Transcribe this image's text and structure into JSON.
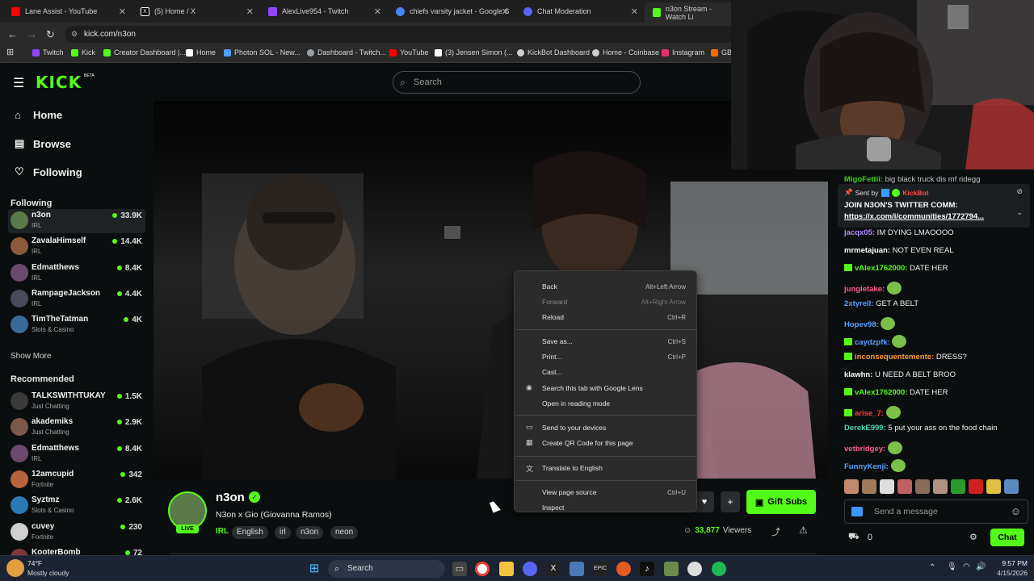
{
  "browser": {
    "tabs": [
      {
        "title": "Lane Assist - YouTube",
        "color": "#ff0000"
      },
      {
        "title": "(5) Home / X",
        "color": "#ffffff"
      },
      {
        "title": "AlexLive954 - Twitch",
        "color": "#9146ff"
      },
      {
        "title": "chiefs varsity jacket - Google S",
        "color": "#4285f4"
      },
      {
        "title": "Chat Moderation",
        "color": "#5865f2"
      },
      {
        "title": "n3on Stream - Watch Li",
        "color": "#53fc18"
      }
    ],
    "url": "kick.com/n3on",
    "bookmarks": [
      {
        "label": "Twitch",
        "color": "#9146ff"
      },
      {
        "label": "Kick",
        "color": "#53fc18"
      },
      {
        "label": "Creator Dashboard |...",
        "color": "#53fc18"
      },
      {
        "label": "Home",
        "color": "#ffffff"
      },
      {
        "label": "Photon SOL - New...",
        "color": "#4ea1ff"
      },
      {
        "label": "Dashboard - Twitch...",
        "color": "#9aa0a6"
      },
      {
        "label": "YouTube",
        "color": "#ff0000"
      },
      {
        "label": "(3) Jensen Simon (...",
        "color": "#ffffff"
      },
      {
        "label": "KickBot Dashboard",
        "color": "#cfcfcf"
      },
      {
        "label": "Home - Coinbase",
        "color": "#cfcfcf"
      },
      {
        "label": "Instagram",
        "color": "#e1306c"
      },
      {
        "label": "GB",
        "color": "#ff6a00"
      }
    ]
  },
  "kick": {
    "logo": "KICK",
    "logo_badge": "BETA",
    "search_placeholder": "Search",
    "nav": [
      {
        "label": "Home",
        "icon": "home-icon"
      },
      {
        "label": "Browse",
        "icon": "browse-icon"
      },
      {
        "label": "Following",
        "icon": "heart-icon"
      }
    ],
    "following_title": "Following",
    "following": [
      {
        "name": "n3on",
        "category": "IRL",
        "viewers": "33.9K",
        "color": "#5a7a4a"
      },
      {
        "name": "ZavalaHimself",
        "category": "IRL",
        "viewers": "14.4K",
        "color": "#8a5a3a"
      },
      {
        "name": "Edmatthews",
        "category": "IRL",
        "viewers": "8.4K",
        "color": "#6a4a6a"
      },
      {
        "name": "RampageJackson",
        "category": "IRL",
        "viewers": "4.4K",
        "color": "#4a4a5a"
      },
      {
        "name": "TimTheTatman",
        "category": "Slots & Casino",
        "viewers": "4K",
        "color": "#3a6a9a"
      }
    ],
    "show_more": "Show More",
    "recommended_title": "Recommended",
    "recommended": [
      {
        "name": "TALKSWITHTUKAY",
        "category": "Just Chatting",
        "viewers": "1.5K",
        "color": "#3a3a3a"
      },
      {
        "name": "akademiks",
        "category": "Just Chatting",
        "viewers": "2.9K",
        "color": "#7a5a4a"
      },
      {
        "name": "Edmatthews",
        "category": "IRL",
        "viewers": "8.4K",
        "color": "#6a4a6a"
      },
      {
        "name": "12amcupid",
        "category": "Fortnite",
        "viewers": "342",
        "color": "#b8643a"
      },
      {
        "name": "Syztmz",
        "category": "Slots & Casino",
        "viewers": "2.6K",
        "color": "#2a7ab8"
      },
      {
        "name": "cuvey",
        "category": "Fortnite",
        "viewers": "230",
        "color": "#d0d0d0"
      },
      {
        "name": "KooterBomb",
        "category": "",
        "viewers": "72",
        "color": "#7a3a3a"
      }
    ]
  },
  "stream": {
    "streamer": "n3on",
    "title": "N3on x Gio (Giovanna Ramos)",
    "live_label": "LIVE",
    "category": "IRL",
    "tags": [
      "English",
      "irl",
      "n3on",
      "neon"
    ],
    "viewers": "33,877",
    "viewers_label": "Viewers",
    "gift_subs": "Gift Subs"
  },
  "chat": {
    "top_partial": {
      "user": "MigoFettii:",
      "text": "big black truck dis mf ridegg"
    },
    "pinned": {
      "sent_by": "Sent by",
      "bot": "KickBot",
      "line1": "JOIN N3ON'S TWITTER COMM:",
      "link": "https://x.com/i/communities/1772794..."
    },
    "messages": [
      {
        "user": "jacqx05:",
        "text": "IM DYING LMAOOOO",
        "color": "#b48cff",
        "badge": false
      },
      {
        "user": "mrmetajuan:",
        "text": "NOT EVEN REAL",
        "color": "#ffffff",
        "badge": false
      },
      {
        "user": "vAlex1762000:",
        "text": "DATE HER",
        "color": "#53fc18",
        "badge": true
      },
      {
        "user": "jungletake:",
        "text": "",
        "color": "#ff5a8a",
        "badge": false
      },
      {
        "user": "2xtyrell:",
        "text": "GET A BELT",
        "color": "#5aa0ff",
        "badge": false
      },
      {
        "user": "Hopev98:",
        "text": "",
        "color": "#5aa0ff",
        "badge": false
      },
      {
        "user": "caydzpfk:",
        "text": "",
        "color": "#5aa0ff",
        "badge": true
      },
      {
        "user": "inconsequentemente:",
        "text": "DRESS?",
        "color": "#ff9a3a",
        "badge": true
      },
      {
        "user": "klawhn:",
        "text": "U NEED A BELT BROO",
        "color": "#ffffff",
        "badge": false
      },
      {
        "user": "vAlex1762000:",
        "text": "DATE HER",
        "color": "#53fc18",
        "badge": true
      },
      {
        "user": "arise_7:",
        "text": "",
        "color": "#ff3a3a",
        "badge": true
      },
      {
        "user": "DerekE999:",
        "text": "5 put your ass on the food chain",
        "color": "#4ad8b0",
        "badge": false
      },
      {
        "user": "vetbridgey:",
        "text": "",
        "color": "#ff5a8a",
        "badge": false
      },
      {
        "user": "FunnyKenji:",
        "text": "",
        "color": "#5aa0ff",
        "badge": false
      }
    ],
    "input_placeholder": "Send a message",
    "points": "0",
    "chat_button": "Chat"
  },
  "context_menu": {
    "items": [
      {
        "label": "Back",
        "shortcut": "Alt+Left Arrow",
        "disabled": false,
        "icon": ""
      },
      {
        "label": "Forward",
        "shortcut": "Alt+Right Arrow",
        "disabled": true,
        "icon": ""
      },
      {
        "label": "Reload",
        "shortcut": "Ctrl+R",
        "disabled": false,
        "icon": ""
      },
      {
        "label": "Save as...",
        "shortcut": "Ctrl+S",
        "disabled": false,
        "icon": ""
      },
      {
        "label": "Print...",
        "shortcut": "Ctrl+P",
        "disabled": false,
        "icon": ""
      },
      {
        "label": "Cast...",
        "shortcut": "",
        "disabled": false,
        "icon": ""
      },
      {
        "label": "Search this tab with Google Lens",
        "shortcut": "",
        "disabled": false,
        "icon": "lens-icon"
      },
      {
        "label": "Open in reading mode",
        "shortcut": "",
        "disabled": false,
        "icon": ""
      },
      {
        "label": "Send to your devices",
        "shortcut": "",
        "disabled": false,
        "icon": "devices-icon"
      },
      {
        "label": "Create QR Code for this page",
        "shortcut": "",
        "disabled": false,
        "icon": "qr-icon"
      },
      {
        "label": "Translate to English",
        "shortcut": "",
        "disabled": false,
        "icon": "translate-icon"
      },
      {
        "label": "View page source",
        "shortcut": "Ctrl+U",
        "disabled": false,
        "icon": ""
      },
      {
        "label": "Inspect",
        "shortcut": "",
        "disabled": false,
        "icon": ""
      }
    ]
  },
  "taskbar": {
    "weather_temp": "74°F",
    "weather_desc": "Mostly cloudy",
    "search": "Search",
    "time": "9:57 PM",
    "date": "4/15/2026"
  },
  "colors": {
    "kick_green": "#53fc18",
    "bg": "#0b0e0f"
  }
}
